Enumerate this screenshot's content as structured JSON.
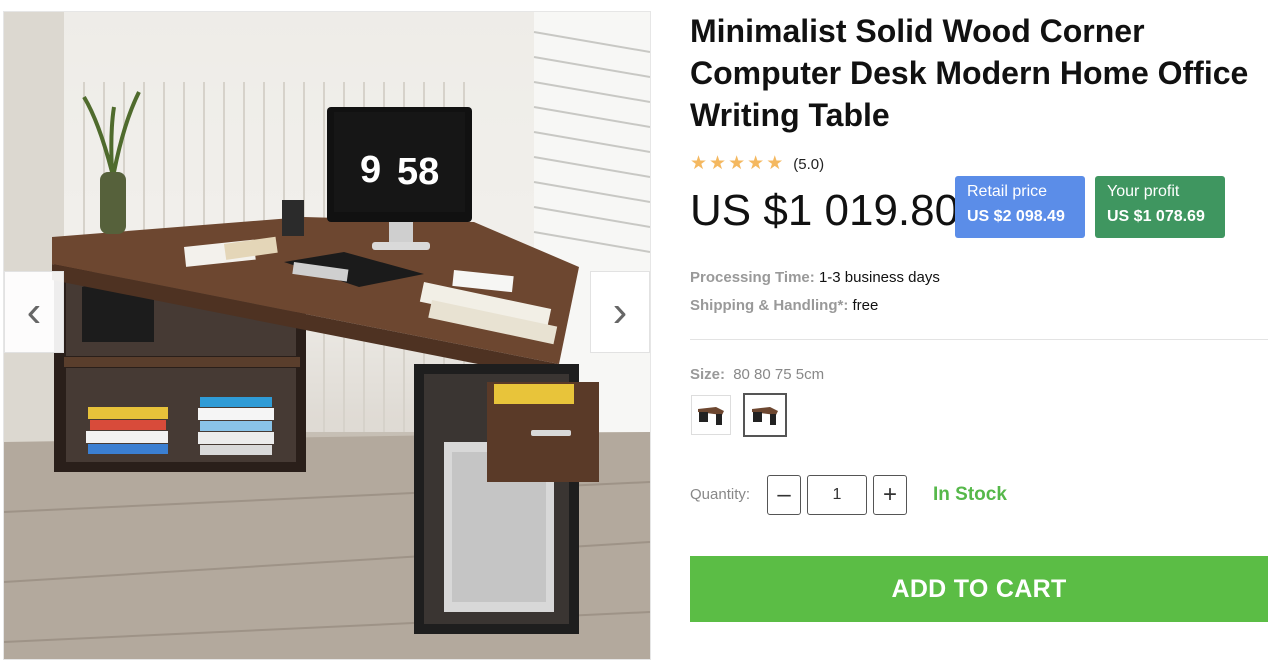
{
  "gallery": {
    "monitor_time_hours": "9",
    "monitor_time_minutes": "58",
    "prev_icon": "chevron-left-icon",
    "next_icon": "chevron-right-icon"
  },
  "product": {
    "title": "Minimalist Solid Wood Corner Computer Desk Modern Home Office Writing Table",
    "rating_stars": 5,
    "rating_text": "(5.0)",
    "price": "US $1 019.80",
    "retail_label": "Retail price",
    "retail_value": "US $2 098.49",
    "profit_label": "Your profit",
    "profit_value": "US $1 078.69",
    "processing_label": "Processing Time:",
    "processing_value": "1-3 business days",
    "shipping_label": "Shipping & Handling*:",
    "shipping_value": "free",
    "size_label": "Size:",
    "size_value": "80 80 75 5cm",
    "quantity_label": "Quantity:",
    "quantity_value": "1",
    "minus_label": "–",
    "plus_label": "+",
    "stock_status": "In Stock",
    "add_to_cart_label": "ADD TO CART"
  },
  "colors": {
    "retail_badge": "#5b8de8",
    "profit_badge": "#3f9660",
    "add_to_cart": "#5bbd45",
    "in_stock": "#56b84a",
    "star": "#f4b860"
  }
}
